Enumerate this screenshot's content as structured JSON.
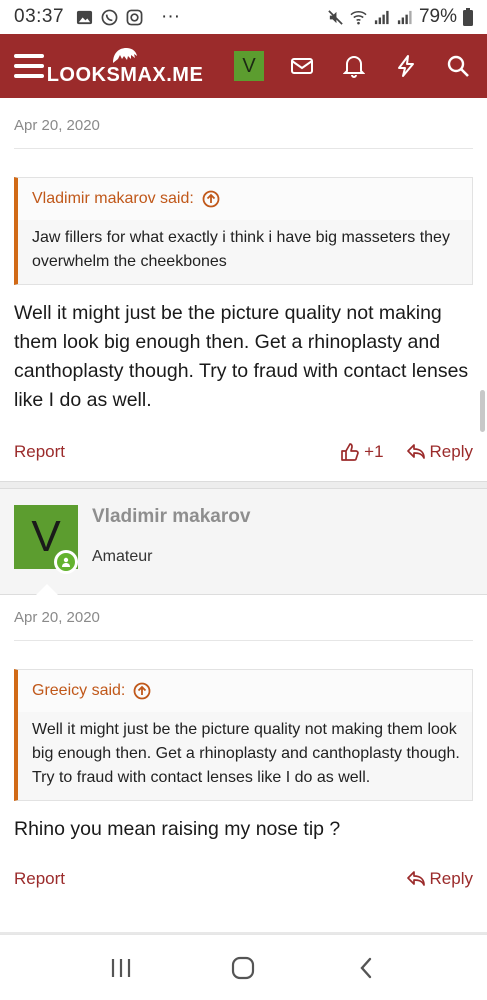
{
  "status_bar": {
    "time": "03:37",
    "more": "···",
    "battery": "79%"
  },
  "header": {
    "logo": "LOOKSMAX.ME",
    "avatar_letter": "V"
  },
  "post1": {
    "date": "Apr 20, 2020",
    "quote_author": "Vladimir makarov said:",
    "quote_text": "Jaw fillers for what exactly i think i have big masseters they overwhelm the cheekbones",
    "body": "Well it might just be the picture quality not making them look big enough then. Get a rhinoplasty and canthoplasty though. Try to fraud with contact lenses like I do as well.",
    "report": "Report",
    "likes": "+1",
    "reply": "Reply"
  },
  "post2": {
    "author": "Vladimir makarov",
    "author_title": "Amateur",
    "avatar_letter": "V",
    "date": "Apr 20, 2020",
    "quote_author": "Greeicy said:",
    "quote_text": "Well it might just be the picture quality not making them look big enough then. Get a rhinoplasty and canthoplasty though. Try to fraud with contact lenses like I do as well.",
    "body": "Rhino you mean raising my nose tip ?",
    "report": "Report",
    "reply": "Reply"
  },
  "colors": {
    "brand": "#9b2b2b",
    "quote_accent": "#d16a17",
    "avatar": "#5c9d2f",
    "online": "#63b32e"
  },
  "icons": [
    "gallery-icon",
    "whatsapp-icon",
    "instagram-icon",
    "mute-icon",
    "wifi-icon",
    "signal-icon",
    "battery-icon",
    "menu-icon",
    "mail-icon",
    "bell-icon",
    "bolt-icon",
    "search-icon",
    "arrow-up-circle-icon",
    "thumbs-up-icon",
    "reply-icon",
    "recent-apps-icon",
    "home-icon",
    "back-icon"
  ]
}
